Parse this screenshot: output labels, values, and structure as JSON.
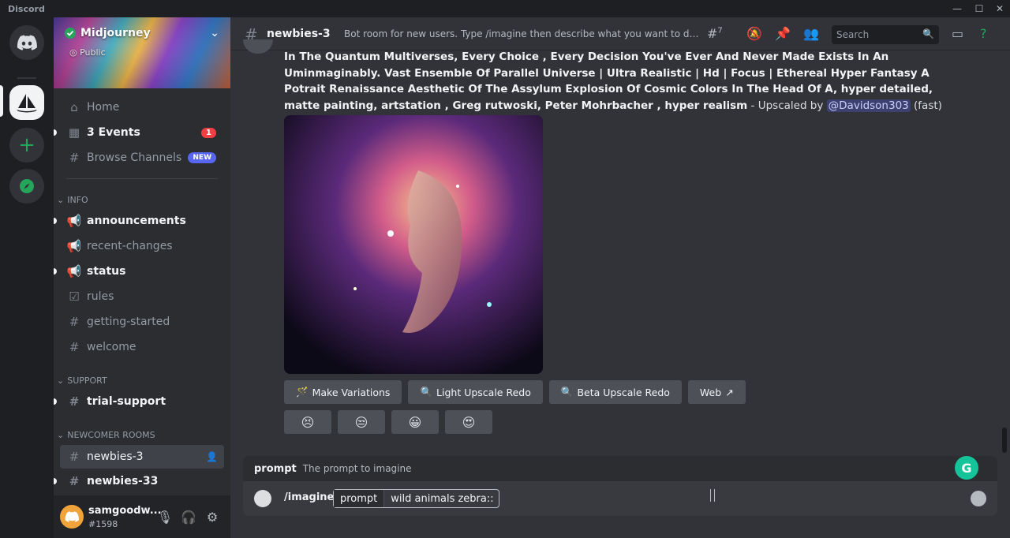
{
  "app_title": "Discord",
  "server": {
    "name": "Midjourney",
    "visibility": "Public"
  },
  "nav": {
    "home": "Home",
    "events": "3 Events",
    "events_count": "1",
    "browse": "Browse Channels",
    "browse_badge": "NEW"
  },
  "categories": {
    "info": "INFO",
    "support": "SUPPORT",
    "newcomer": "NEWCOMER ROOMS"
  },
  "channels_info": [
    "announcements",
    "recent-changes",
    "status",
    "rules",
    "getting-started",
    "welcome"
  ],
  "channels_support": [
    "trial-support"
  ],
  "channels_newcomer": [
    "newbies-3",
    "newbies-33"
  ],
  "user": {
    "name": "samgoodw...",
    "tag": "#1598"
  },
  "header": {
    "channel": "newbies-3",
    "topic": "Bot room for new users. Type /imagine then describe what you want to draw. S...",
    "threads_count": "7",
    "search_placeholder": "Search"
  },
  "message": {
    "prompt_bold": "In The Quantum Multiverses, Every Choice , Every Decision You've Ever And Never Made Exists In An Uminmaginably. Vast Ensemble Of Parallel Universe | Ultra Realistic | Hd | Focus | Ethereal Hyper Fantasy A Potrait Renaissance Aesthetic Of The Assylum Explosion Of Cosmic Colors In The Head Of A, hyper detailed, matte painting, artstation , Greg rutwoski, Peter Mohrbacher , hyper realism",
    "suffix": " - Upscaled by ",
    "mention": "@Davidson303",
    "speed": " (fast)"
  },
  "buttons": {
    "variations": "Make Variations",
    "light_redo": "Light Upscale Redo",
    "beta_redo": "Beta Upscale Redo",
    "web": "Web"
  },
  "option_hint": {
    "name": "prompt",
    "desc": "The prompt to imagine"
  },
  "composer": {
    "command": "/imagine",
    "option_key": "prompt",
    "option_value": "wild animals zebra::"
  },
  "colors": {
    "accent": "#5865f2",
    "online": "#23a55a",
    "grammarly": "#15c39a"
  }
}
